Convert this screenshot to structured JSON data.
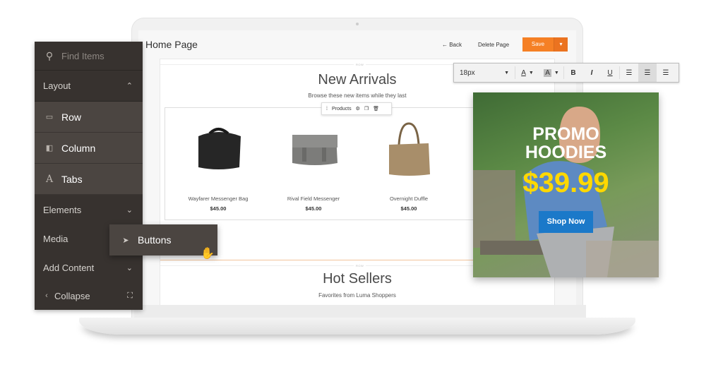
{
  "header": {
    "title": "Home Page",
    "back_label": "← Back",
    "delete_label": "Delete Page",
    "save_label": "Save",
    "save_dropdown_icon": "▾"
  },
  "sidebar": {
    "search_placeholder": "Find Items",
    "items": [
      {
        "label": "Layout",
        "chevron": "︿",
        "type": "head"
      },
      {
        "label": "Row",
        "icon": "row-icon",
        "type": "sub"
      },
      {
        "label": "Column",
        "icon": "column-icon",
        "type": "sub"
      },
      {
        "label": "Tabs",
        "icon": "tabs-icon",
        "type": "sub"
      },
      {
        "label": "Elements",
        "chevron": "﹀",
        "type": "head"
      },
      {
        "label": "Media",
        "type": "head"
      },
      {
        "label": "Add Content",
        "chevron": "﹀",
        "type": "head"
      },
      {
        "label": "Collapse",
        "type": "footer"
      }
    ],
    "dragging_item": "Buttons"
  },
  "stage": {
    "row_label": "ROW",
    "new_arrivals": {
      "title": "New Arrivals",
      "subtitle": "Browse these new items while they last",
      "toolbar_label": "Products",
      "products": [
        {
          "name": "Wayfarer Messenger Bag",
          "price": "$45.00",
          "color": "#2a2a2a"
        },
        {
          "name": "Rival Field Messenger",
          "price": "$45.00",
          "color": "#8a8a88"
        },
        {
          "name": "Overnight Duffle",
          "price": "$45.00",
          "color": "#a88e6a"
        }
      ]
    },
    "hot_sellers": {
      "title": "Hot Sellers",
      "subtitle": "Favorites from Luma Shoppers",
      "models": [
        "#5b3fa0",
        "#f4b5c4",
        "#4aa6e0",
        "#555555",
        "#b0201e",
        "#1f8f62"
      ]
    }
  },
  "text_toolbar": {
    "font_size": "18px",
    "buttons": [
      "A",
      "A",
      "B",
      "I",
      "U"
    ]
  },
  "promo": {
    "line1": "PROMO",
    "line2": "HOODIES",
    "price": "$39.99",
    "cta": "Shop Now"
  }
}
